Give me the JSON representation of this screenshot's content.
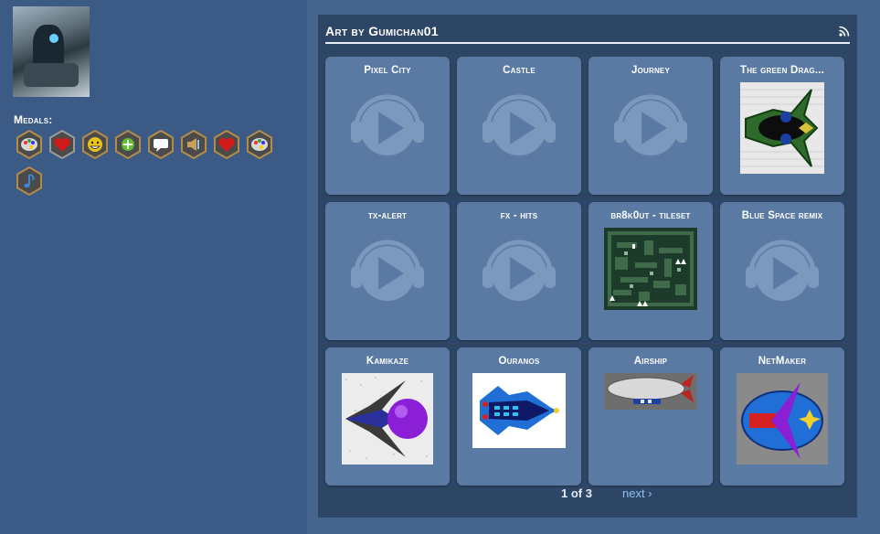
{
  "sidebar": {
    "medals_label": "Medals:",
    "medals": [
      {
        "icon": "paint-palette-icon",
        "color": "#c7c7c7"
      },
      {
        "icon": "heart-icon",
        "color": "#d31919"
      },
      {
        "icon": "grinning-face-icon",
        "color": "#e6c41d"
      },
      {
        "icon": "plus-icon",
        "color": "#5fbf2d"
      },
      {
        "icon": "speech-bubble-icon",
        "color": "#ffffff"
      },
      {
        "icon": "speaker-icon",
        "color": "#c9a15c"
      },
      {
        "icon": "heart-icon",
        "color": "#d31919"
      },
      {
        "icon": "paint-palette-icon",
        "color": "#c7c7c7"
      },
      {
        "icon": "music-note-icon",
        "color": "#3a8ad6"
      }
    ]
  },
  "panel": {
    "title": "Art by Gumichan01",
    "rss_icon": "rss-feed-icon",
    "items": [
      {
        "title": "Pixel City",
        "thumb": "audio-play-icon"
      },
      {
        "title": "Castle",
        "thumb": "audio-play-icon"
      },
      {
        "title": "Journey",
        "thumb": "audio-play-icon"
      },
      {
        "title": "The green Drag...",
        "thumb": "green-dragon-ship-art"
      },
      {
        "title": "tx-alert",
        "thumb": "audio-play-icon"
      },
      {
        "title": "fx - hits",
        "thumb": "audio-play-icon"
      },
      {
        "title": "br8k0ut - tileset",
        "thumb": "tileset-art"
      },
      {
        "title": "Blue Space remix",
        "thumb": "audio-play-icon"
      },
      {
        "title": "Kamikaze",
        "thumb": "kamikaze-ship-art"
      },
      {
        "title": "Ouranos",
        "thumb": "ouranos-ship-art"
      },
      {
        "title": "Airship",
        "thumb": "airship-art"
      },
      {
        "title": "NetMaker",
        "thumb": "netmaker-ship-art"
      }
    ]
  },
  "pagination": {
    "page_label": "1 of 3",
    "next_label": "next ›"
  }
}
